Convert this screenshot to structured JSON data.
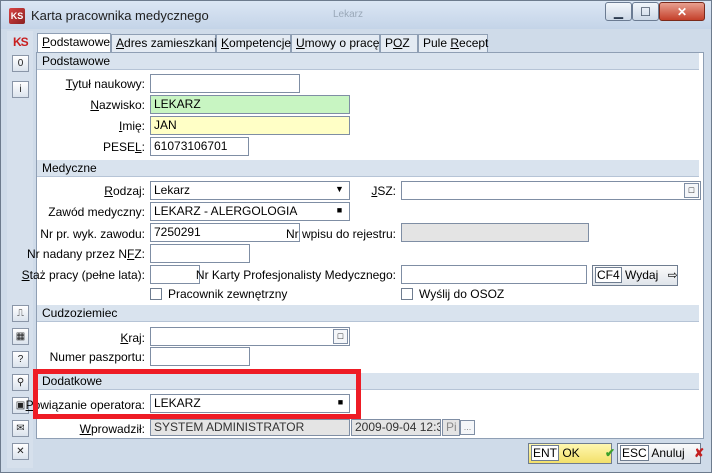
{
  "window": {
    "title": "Karta pracownika medycznego",
    "ghost_title": "Lekarz",
    "minimize_icon": "minimize-icon",
    "maximize_icon": "maximize-icon",
    "close_icon": "close-icon",
    "min_glyph": "▁",
    "max_glyph": "☐",
    "close_glyph": "✕"
  },
  "app_logo": "KS",
  "left_toolbar": {
    "top_items": [
      {
        "glyph": "0",
        "icon": "zero-icon"
      },
      {
        "glyph": "i",
        "icon": "info-icon"
      }
    ],
    "bottom_items": [
      {
        "glyph": "⎍",
        "icon": "monitor-icon"
      },
      {
        "glyph": "▦",
        "icon": "calculator-icon"
      },
      {
        "glyph": "?",
        "icon": "help-icon"
      },
      {
        "glyph": "⚲",
        "icon": "search-icon"
      },
      {
        "glyph": "▣",
        "icon": "card-icon"
      },
      {
        "glyph": "✉",
        "icon": "mail-icon"
      },
      {
        "glyph": "✕",
        "icon": "close-icon"
      }
    ]
  },
  "tabs": [
    {
      "pre": "",
      "u": "P",
      "post": "odstawowe"
    },
    {
      "pre": "",
      "u": "A",
      "post": "dres zamieszkania"
    },
    {
      "pre": "",
      "u": "K",
      "post": "ompetencje"
    },
    {
      "pre": "",
      "u": "U",
      "post": "mowy o pracę"
    },
    {
      "pre": "P",
      "u": "O",
      "post": "Z"
    },
    {
      "pre": "Pule ",
      "u": "R",
      "post": "ecept"
    }
  ],
  "sections": {
    "podstawowe": "Podstawowe",
    "medyczne": "Medyczne",
    "cudzoziemiec": "Cudzoziemiec",
    "dodatkowe": "Dodatkowe"
  },
  "podstawowe": {
    "tytul": {
      "pre": "",
      "u": "T",
      "post": "ytuł naukowy:",
      "value": ""
    },
    "nazwisko": {
      "pre": "",
      "u": "N",
      "post": "azwisko:",
      "value": "LEKARZ"
    },
    "imie": {
      "pre": "",
      "u": "I",
      "post": "mię:",
      "value": "JAN"
    },
    "pesel": {
      "pre": "PESE",
      "u": "L",
      "post": ":",
      "value": "61073106701"
    }
  },
  "medyczne": {
    "rodzaj": {
      "pre": "",
      "u": "R",
      "post": "odzaj:",
      "value": "Lekarz",
      "dropdown_glyph": "▼"
    },
    "jsz": {
      "pre": "",
      "u": "J",
      "post": "SZ:",
      "value": "",
      "btn_glyph": "□"
    },
    "zawod": {
      "label": "Zawód medyczny:",
      "value": "LEKARZ - ALERGOLOGIA",
      "btn_glyph": "■"
    },
    "nr_pr": {
      "label": "Nr pr. wyk. zawodu:",
      "value": "7250291"
    },
    "nr_wpisu": {
      "label": "Nr wpisu do rejestru:",
      "value": ""
    },
    "nfz": {
      "pre": "Nr nadany przez N",
      "u": "F",
      "post": "Z:",
      "value": ""
    },
    "staz": {
      "pre": "",
      "u": "S",
      "post": "taż pracy (pełne lata):",
      "value": ""
    },
    "karta": {
      "label": "Nr Karty Profesjonalisty Medycznego:",
      "value": ""
    },
    "wydaj_key": "CF4",
    "wydaj_label": "Wydaj",
    "wydaj_glyph": "⇨",
    "pracownik_zewn": "Pracownik zewnętrzny",
    "wyslij": "Wyślij do OSOZ"
  },
  "cudzoziemiec": {
    "kraj": {
      "pre": "",
      "u": "K",
      "post": "raj:",
      "value": "",
      "btn_glyph": "□"
    },
    "paszport": {
      "label": "Numer paszportu:",
      "value": ""
    }
  },
  "dodatkowe": {
    "operator": {
      "pre": "",
      "u": "P",
      "post": "owiązanie operatora:",
      "value": "LEKARZ",
      "btn_glyph": "■"
    },
    "wprowadzil": {
      "pre": "",
      "u": "W",
      "post": "prowadził:",
      "value": "SYSTEM ADMINISTRATOR",
      "date": "2009-09-04 12:37",
      "extra": "Pi",
      "extra_btn": "..."
    }
  },
  "footer": {
    "ok_key": "ENT",
    "ok_label": "OK",
    "ok_glyph": "✔",
    "cancel_key": "ESC",
    "cancel_label": "Anuluj",
    "cancel_glyph": "✘"
  },
  "colors": {
    "highlight": "#ee1c25",
    "nazwisko_bg": "#c8f5c2",
    "imie_bg": "#ffffc6"
  }
}
